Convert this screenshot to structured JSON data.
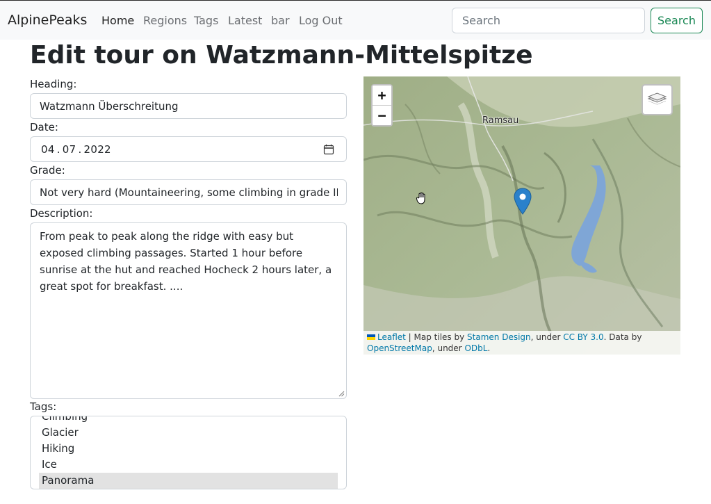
{
  "navbar": {
    "brand": "AlpinePeaks",
    "items": [
      {
        "label": "Home",
        "active": true
      },
      {
        "label": "Regions",
        "active": false
      },
      {
        "label": "Tags",
        "active": false
      },
      {
        "label": "Latest",
        "active": false
      },
      {
        "label": "bar",
        "active": false
      },
      {
        "label": "Log Out",
        "active": false
      }
    ],
    "search": {
      "placeholder": "Search",
      "button_label": "Search"
    }
  },
  "page": {
    "title": "Edit tour on Watzmann-Mittelspitze"
  },
  "form": {
    "heading": {
      "label": "Heading:",
      "value": "Watzmann Überschreitung"
    },
    "date": {
      "label": "Date:",
      "day": "04",
      "month": "07",
      "year": "2022",
      "separator": "."
    },
    "grade": {
      "label": "Grade:",
      "value": "Not very hard (Mountaineering, some climbing in grade II, fe"
    },
    "description": {
      "label": "Description:",
      "value": "From peak to peak along the ridge with easy but exposed climbing passages. Started 1 hour before sunrise at the hut and reached Hocheck 2 hours later, a great spot for breakfast. ...."
    },
    "tags": {
      "label": "Tags:",
      "options": [
        {
          "label": "Climbing",
          "selected": false
        },
        {
          "label": "Glacier",
          "selected": false
        },
        {
          "label": "Hiking",
          "selected": false
        },
        {
          "label": "Ice",
          "selected": false
        },
        {
          "label": "Panorama",
          "selected": true
        }
      ]
    }
  },
  "map": {
    "zoom_in": "+",
    "zoom_out": "−",
    "place_labels": [
      "Ramsau"
    ],
    "colors": {
      "water": "#7fa6d6",
      "marker": "#2a81cb",
      "accent": "#198754",
      "link": "#0078a8"
    },
    "attribution": {
      "leaflet": "Leaflet",
      "sep1": " | Map tiles by ",
      "stamen": "Stamen Design",
      "sep2": ", under ",
      "ccby": "CC BY 3.0",
      "sep3": ". Data by",
      "osm": "OpenStreetMap",
      "sep4": ", under ",
      "odbl": "ODbL",
      "end": "."
    }
  }
}
